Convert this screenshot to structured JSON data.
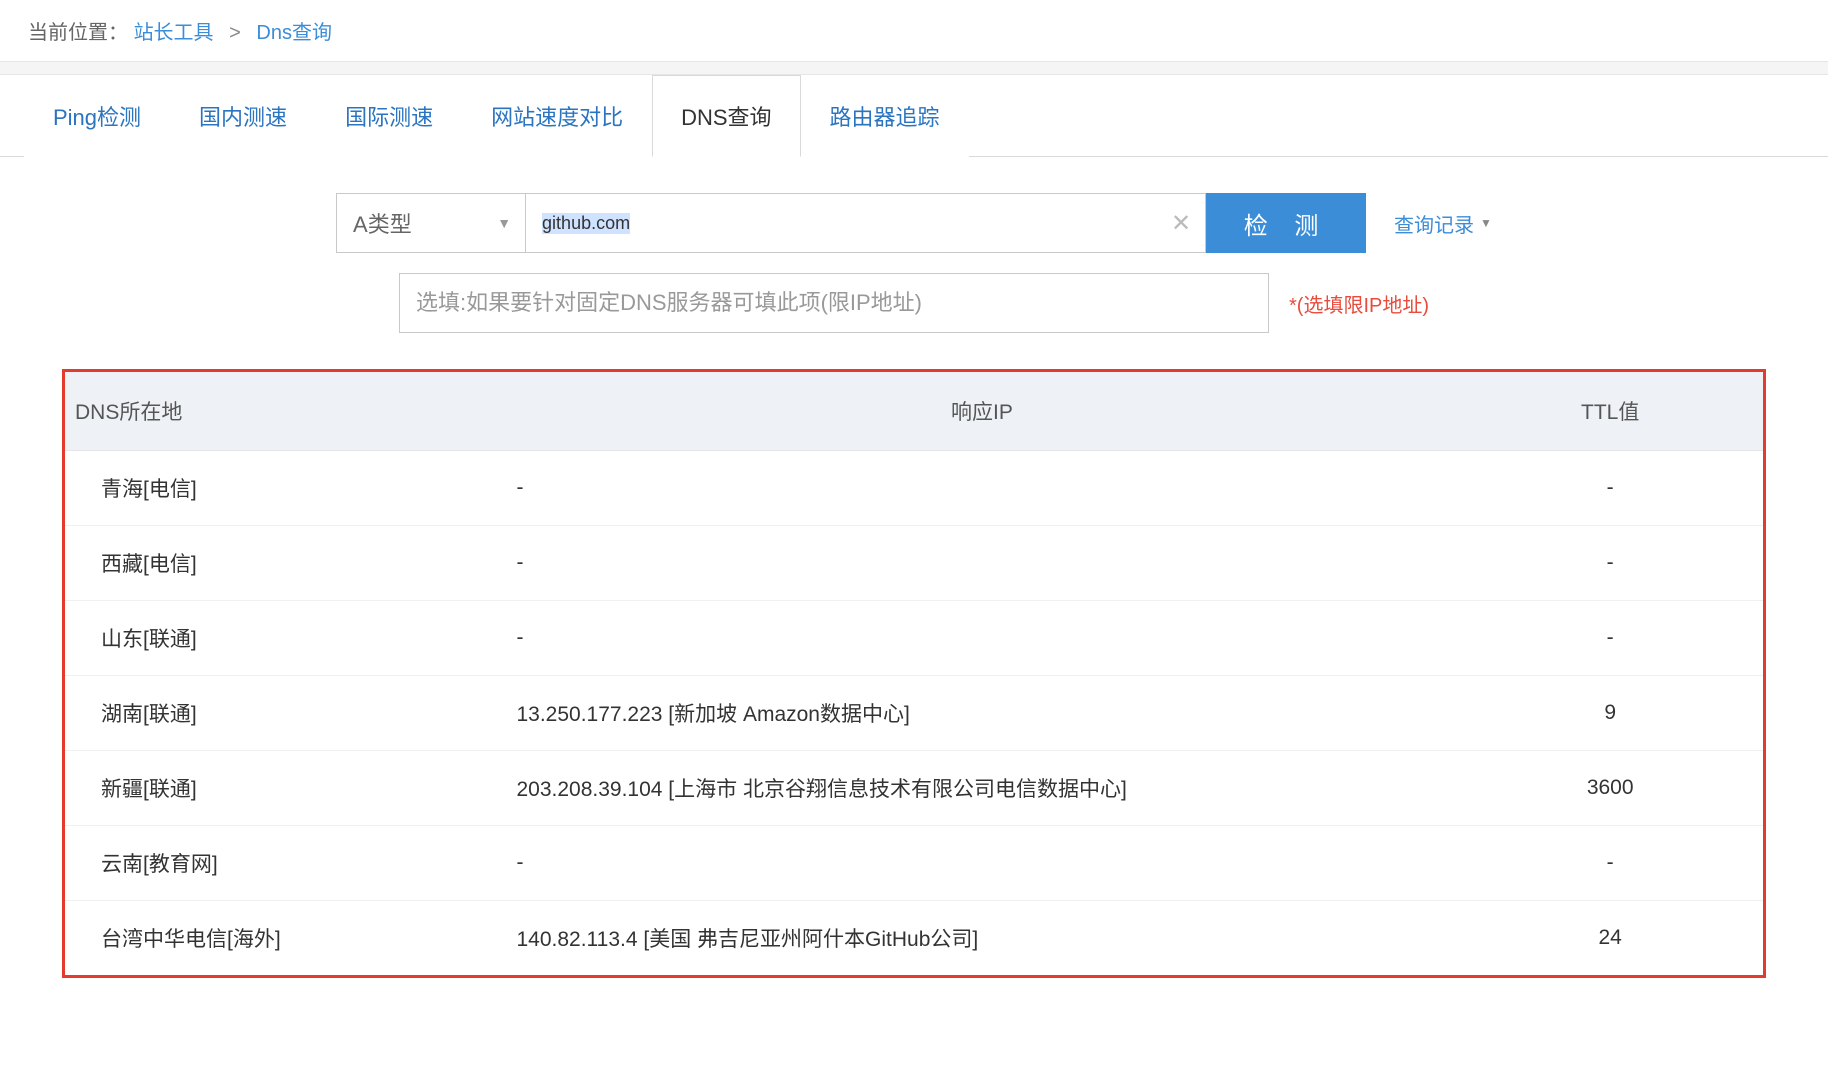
{
  "breadcrumb": {
    "label": "当前位置：",
    "link1": "站长工具",
    "sep": ">",
    "link2": "Dns查询"
  },
  "tabs": [
    {
      "label": "Ping检测",
      "active": false
    },
    {
      "label": "国内测速",
      "active": false
    },
    {
      "label": "国际测速",
      "active": false
    },
    {
      "label": "网站速度对比",
      "active": false
    },
    {
      "label": "DNS查询",
      "active": true
    },
    {
      "label": "路由器追踪",
      "active": false
    }
  ],
  "form": {
    "record_type": "A类型",
    "domain": "github.com",
    "submit": "检 测",
    "history": "查询记录",
    "dns_placeholder": "选填:如果要针对固定DNS服务器可填此项(限IP地址)",
    "note": "*(选填限IP地址)"
  },
  "table": {
    "headers": {
      "loc": "DNS所在地",
      "ip": "响应IP",
      "ttl": "TTL值"
    },
    "rows": [
      {
        "loc": "青海[电信]",
        "ip": "-",
        "ttl": "-"
      },
      {
        "loc": "西藏[电信]",
        "ip": "-",
        "ttl": "-"
      },
      {
        "loc": "山东[联通]",
        "ip": "-",
        "ttl": "-"
      },
      {
        "loc": "湖南[联通]",
        "ip": "13.250.177.223 [新加坡 Amazon数据中心]",
        "ttl": "9"
      },
      {
        "loc": "新疆[联通]",
        "ip": "203.208.39.104 [上海市 北京谷翔信息技术有限公司电信数据中心]",
        "ttl": "3600"
      },
      {
        "loc": "云南[教育网]",
        "ip": "-",
        "ttl": "-"
      },
      {
        "loc": "台湾中华电信[海外]",
        "ip": "140.82.113.4 [美国 弗吉尼亚州阿什本GitHub公司]",
        "ttl": "24"
      }
    ]
  }
}
